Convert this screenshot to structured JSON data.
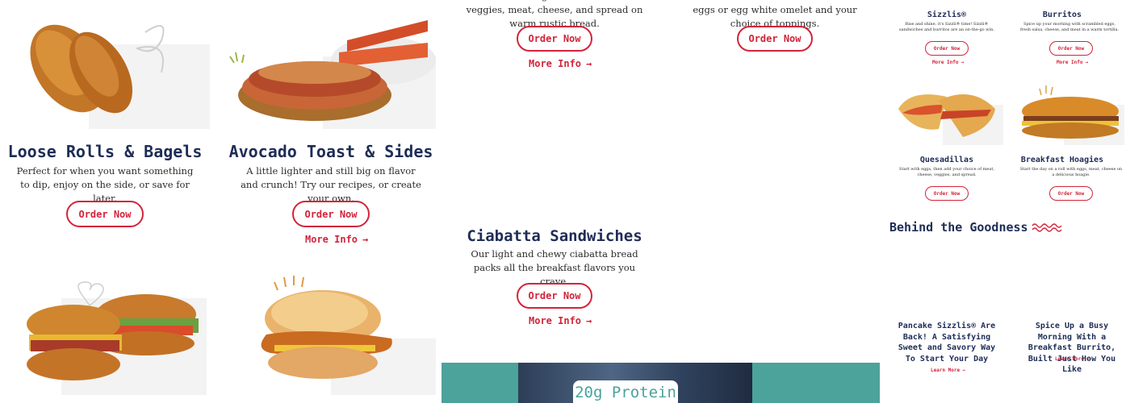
{
  "colors": {
    "brand_red": "#d2243a",
    "navy": "#1e2d57",
    "teal": "#4ba39b"
  },
  "cards": {
    "loose": {
      "title": "Loose Rolls & Bagels",
      "desc": "Perfect for when you want something to dip, enjoy on the side, or save for later.",
      "order": "Order Now"
    },
    "avocado": {
      "title": "Avocado Toast & Sides",
      "desc": "A little lighter and still big on flavor and crunch! Try our recipes, or create your own.",
      "order": "Order Now",
      "more": "More Info"
    },
    "top_middle": {
      "desc": "Choose the right combination of veggies, meat, cheese, and spread on warm rustic bread.",
      "order": "Order Now",
      "more": "More Info"
    },
    "top_right": {
      "desc": "Breakfast sandwiches made with fresh eggs or egg white omelet and your choice of toppings.",
      "order": "Order Now"
    },
    "ciabatta": {
      "title": "Ciabatta Sandwiches",
      "desc": "Our light and chewy ciabatta bread packs all the breakfast flavors you crave.",
      "order": "Order Now",
      "more": "More Info"
    }
  },
  "promo": {
    "badge": "20g Protein"
  },
  "mini_cards": {
    "sizzlis": {
      "title": "Sizzlis®",
      "desc": "Rise and shine, it's Sizzli® time! Sizzli® sandwiches and burritos are an on-the-go win.",
      "order": "Order Now",
      "more": "More Info"
    },
    "burritos": {
      "title": "Burritos",
      "desc": "Spice up your morning with scrambled eggs, fresh salsa, cheese, and meat in a warm tortilla.",
      "order": "Order Now",
      "more": "More Info"
    },
    "quesadillas": {
      "title": "Quesadillas",
      "desc": "Start with eggs, then add your choice of meat, cheese, veggies, and spread.",
      "order": "Order Now"
    },
    "hoagies": {
      "title": "Breakfast Hoagies",
      "desc": "Start the day on a roll with eggs, meat, cheese on a delicious hoagie.",
      "order": "Order Now"
    }
  },
  "behind": {
    "heading": "Behind the Goodness",
    "articles": [
      {
        "title": "Pancake Sizzlis® Are Back! A Satisfying Sweet and Savory Way To Start Your Day",
        "link": "Learn More"
      },
      {
        "title": "Spice Up a Busy Morning With a Breakfast Burrito, Built Just How You Like",
        "link": "Learn More"
      }
    ]
  }
}
